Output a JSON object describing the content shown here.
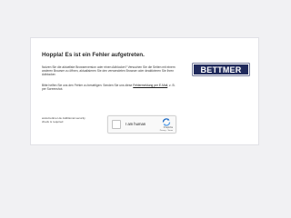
{
  "error": {
    "title": "Hoppla! Es ist ein Fehler aufgetreten.",
    "paragraph1": "Nutzen Sie die aktuellste Browserversion oder einen Adblocker? Versuchen Sie die Seiten mit einem anderen Browser zu öffnen, aktualisieren Sie den verwendeten Browser oder deaktivieren Sie Ihren Adblocker.",
    "paragraph2_before": "Bitte helfen Sie uns den Fehler zu beseitigen: Senden Sie uns diese",
    "paragraph2_link": "Fehlermeldung per E-Mail",
    "paragraph2_after": ", z. B. per Screenshot."
  },
  "brand": {
    "logo_text": "BETTMER",
    "color": "#202a5c"
  },
  "security": {
    "note": "www.bettmer.de Additional security check is required"
  },
  "captcha": {
    "label": "I am human",
    "brand": "hCaptcha",
    "terms": "Privacy · Terms"
  }
}
